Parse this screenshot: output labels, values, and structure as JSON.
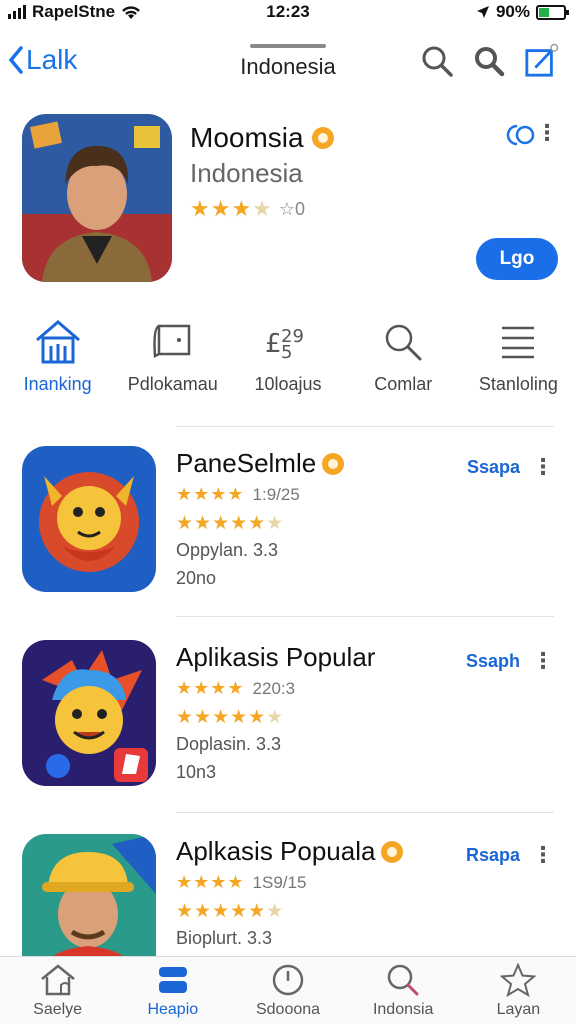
{
  "status_bar": {
    "carrier": "RapelStne",
    "time": "12:23",
    "battery": "90%"
  },
  "nav": {
    "back_label": "Lalk",
    "title": "Indonesia"
  },
  "featured": {
    "title": "Moomsia",
    "subtitle": "Indonesia",
    "rating_text": "★★★★",
    "rating_count": "☆0",
    "get_label": "Lgo"
  },
  "tabs": [
    {
      "label": "Inanking",
      "icon": "home-icon"
    },
    {
      "label": "Pdlokamau",
      "icon": "book-icon"
    },
    {
      "label": "10loajus",
      "icon": "numbers-icon"
    },
    {
      "label": "Comlar",
      "icon": "search-icon"
    },
    {
      "label": "Stanloling",
      "icon": "list-icon"
    }
  ],
  "apps": [
    {
      "title": "PaneSelmle",
      "rating_count": "1:9/25",
      "info": "Oppylan. 3.3",
      "size": "20no",
      "action": "Ssapa",
      "badge": true
    },
    {
      "title": "Aplikasis Popular",
      "rating_count": "220:3",
      "info": "Doplasin. 3.3",
      "size": "10n3",
      "action": "Ssaph",
      "badge": false
    },
    {
      "title": "Aplkasis Popuala",
      "rating_count": "1S9/15",
      "info": "Bioplurt. 3.3",
      "size": "",
      "action": "Rsapa",
      "badge": true
    }
  ],
  "tab_bar": [
    {
      "label": "Saelye",
      "icon": "home-icon"
    },
    {
      "label": "Heapio",
      "icon": "apps-icon"
    },
    {
      "label": "Sdooona",
      "icon": "clock-icon"
    },
    {
      "label": "Indonsia",
      "icon": "search-icon"
    },
    {
      "label": "Layan",
      "icon": "star-icon"
    }
  ],
  "colors": {
    "accent": "#1a6ee8",
    "star": "#f5a623"
  }
}
